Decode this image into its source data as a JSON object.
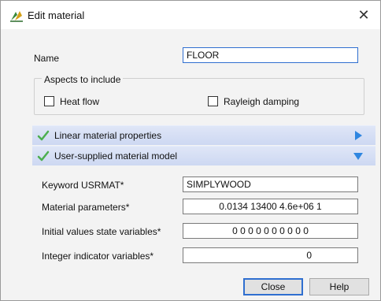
{
  "window": {
    "title": "Edit material",
    "icons": {
      "app": "material-app-icon",
      "close": "close-icon"
    }
  },
  "name": {
    "label": "Name",
    "value": "FLOOR"
  },
  "aspects": {
    "title": "Aspects to include",
    "options": [
      {
        "label": "Heat flow",
        "checked": false
      },
      {
        "label": "Rayleigh damping",
        "checked": false
      }
    ]
  },
  "sections": [
    {
      "title": "Linear material properties",
      "expanded": false,
      "icon": "check-icon",
      "arrow": "expand-right-icon"
    },
    {
      "title": "User-supplied material model",
      "expanded": true,
      "icon": "check-icon",
      "arrow": "collapse-down-icon"
    }
  ],
  "usermodel": {
    "fields": [
      {
        "label": "Keyword USRMAT*",
        "value": "SIMPLYWOOD"
      },
      {
        "label": "Material parameters*",
        "value": "0.0134 13400 4.6e+06 1"
      },
      {
        "label": "Initial values state variables*",
        "value": "0 0 0 0 0 0 0 0 0 0"
      },
      {
        "label": "Integer indicator variables*",
        "value": "0"
      }
    ]
  },
  "buttons": {
    "close": "Close",
    "help": "Help"
  },
  "colors": {
    "accent": "#2f6fd0",
    "check": "#4caf50",
    "section_bg": "#d3ddf4"
  }
}
